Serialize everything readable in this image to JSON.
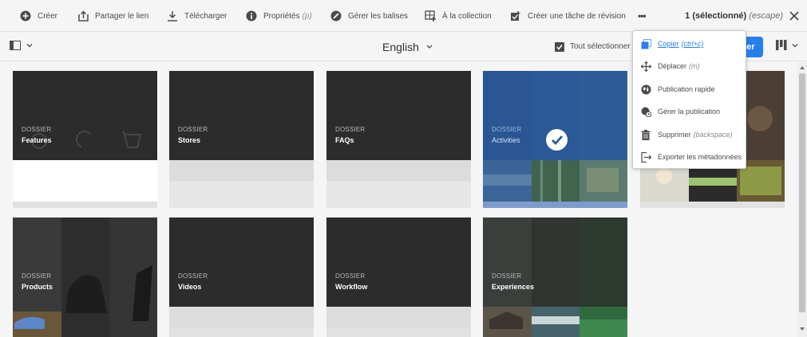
{
  "actionbar": {
    "create": "Créer",
    "share": "Partager le lien",
    "download": "Télécharger",
    "properties": "Propriétés",
    "properties_kbd": "(p)",
    "tags": "Gérer les balises",
    "collection": "À la collection",
    "review": "Créer une tâche de révision",
    "more": "•••",
    "selection": "1 (sélectionné)",
    "escape": "(escape)"
  },
  "topbar": {
    "language": "English",
    "select_all": "Tout sélectionner",
    "create_partial": "éer"
  },
  "cards": [
    {
      "kind": "DOSSIER",
      "title": "Features"
    },
    {
      "kind": "DOSSIER",
      "title": "Stores"
    },
    {
      "kind": "DOSSIER",
      "title": "FAQs"
    },
    {
      "kind": "DOSSIER",
      "title": "Activities"
    },
    {
      "kind": "DOSSIER",
      "title": "Products"
    },
    {
      "kind": "DOSSIER",
      "title": "Videos"
    },
    {
      "kind": "DOSSIER",
      "title": "Workflow"
    },
    {
      "kind": "DOSSIER",
      "title": "Experiences"
    }
  ],
  "menu": {
    "copy": "Copier",
    "copy_kbd": "(ctrl+c)",
    "move": "Déplacer",
    "move_kbd": "(m)",
    "quick_publish": "Publication rapide",
    "manage_publication": "Gérer la publication",
    "delete": "Supprimer",
    "delete_kbd": "(backspace)",
    "export_metadata": "Exporter les métadonnées"
  },
  "colors": {
    "accent": "#2680eb",
    "selected_card": "#2d5a9a",
    "card_dark": "#2c2c2c"
  }
}
